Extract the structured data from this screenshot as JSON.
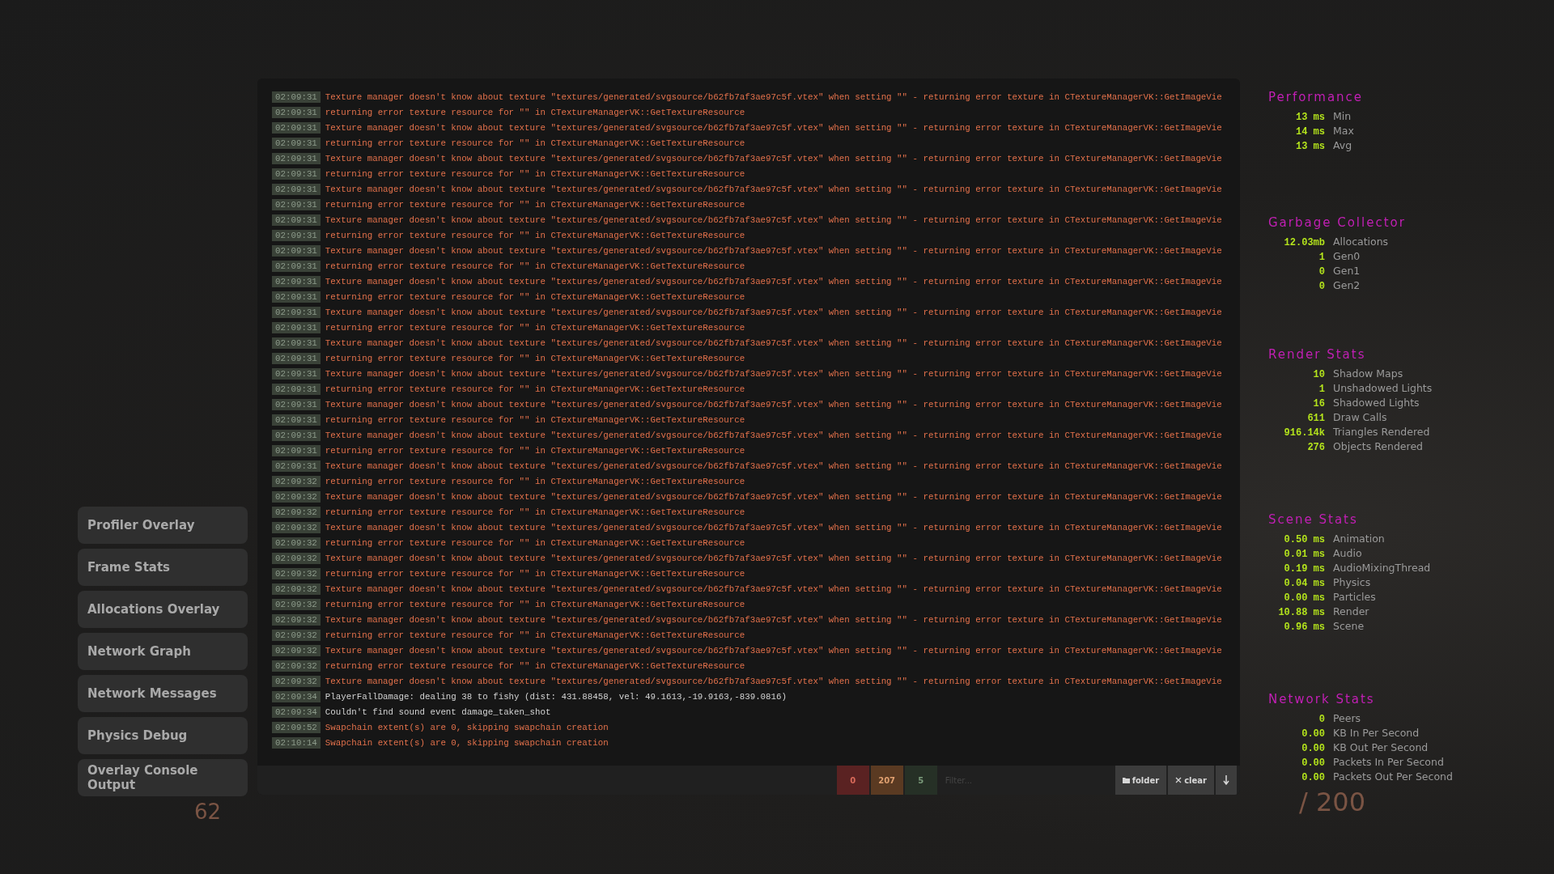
{
  "menu": [
    {
      "label": "Profiler Overlay"
    },
    {
      "label": "Frame Stats"
    },
    {
      "label": "Allocations Overlay"
    },
    {
      "label": "Network Graph"
    },
    {
      "label": "Network Messages"
    },
    {
      "label": "Physics Debug"
    },
    {
      "label": "Overlay Console Output"
    }
  ],
  "hud": {
    "left_number": "62",
    "right_number": "/ 200"
  },
  "console": {
    "lines": [
      {
        "time": "02:09:31",
        "kind": "error",
        "text": "Texture manager doesn't know about texture \"textures/generated/svgsource/b62fb7af3ae97c5f.vtex\" when setting \"\" - returning error texture in CTextureManagerVK::GetImageVie"
      },
      {
        "time": "02:09:31",
        "kind": "error",
        "text": "returning error texture resource for \"\" in CTextureManagerVK::GetTextureResource"
      },
      {
        "time": "02:09:31",
        "kind": "error",
        "text": "Texture manager doesn't know about texture \"textures/generated/svgsource/b62fb7af3ae97c5f.vtex\" when setting \"\" - returning error texture in CTextureManagerVK::GetImageVie"
      },
      {
        "time": "02:09:31",
        "kind": "error",
        "text": "returning error texture resource for \"\" in CTextureManagerVK::GetTextureResource"
      },
      {
        "time": "02:09:31",
        "kind": "error",
        "text": "Texture manager doesn't know about texture \"textures/generated/svgsource/b62fb7af3ae97c5f.vtex\" when setting \"\" - returning error texture in CTextureManagerVK::GetImageVie"
      },
      {
        "time": "02:09:31",
        "kind": "error",
        "text": "returning error texture resource for \"\" in CTextureManagerVK::GetTextureResource"
      },
      {
        "time": "02:09:31",
        "kind": "error",
        "text": "Texture manager doesn't know about texture \"textures/generated/svgsource/b62fb7af3ae97c5f.vtex\" when setting \"\" - returning error texture in CTextureManagerVK::GetImageVie"
      },
      {
        "time": "02:09:31",
        "kind": "error",
        "text": "returning error texture resource for \"\" in CTextureManagerVK::GetTextureResource"
      },
      {
        "time": "02:09:31",
        "kind": "error",
        "text": "Texture manager doesn't know about texture \"textures/generated/svgsource/b62fb7af3ae97c5f.vtex\" when setting \"\" - returning error texture in CTextureManagerVK::GetImageVie"
      },
      {
        "time": "02:09:31",
        "kind": "error",
        "text": "returning error texture resource for \"\" in CTextureManagerVK::GetTextureResource"
      },
      {
        "time": "02:09:31",
        "kind": "error",
        "text": "Texture manager doesn't know about texture \"textures/generated/svgsource/b62fb7af3ae97c5f.vtex\" when setting \"\" - returning error texture in CTextureManagerVK::GetImageVie"
      },
      {
        "time": "02:09:31",
        "kind": "error",
        "text": "returning error texture resource for \"\" in CTextureManagerVK::GetTextureResource"
      },
      {
        "time": "02:09:31",
        "kind": "error",
        "text": "Texture manager doesn't know about texture \"textures/generated/svgsource/b62fb7af3ae97c5f.vtex\" when setting \"\" - returning error texture in CTextureManagerVK::GetImageVie"
      },
      {
        "time": "02:09:31",
        "kind": "error",
        "text": "returning error texture resource for \"\" in CTextureManagerVK::GetTextureResource"
      },
      {
        "time": "02:09:31",
        "kind": "error",
        "text": "Texture manager doesn't know about texture \"textures/generated/svgsource/b62fb7af3ae97c5f.vtex\" when setting \"\" - returning error texture in CTextureManagerVK::GetImageVie"
      },
      {
        "time": "02:09:31",
        "kind": "error",
        "text": "returning error texture resource for \"\" in CTextureManagerVK::GetTextureResource"
      },
      {
        "time": "02:09:31",
        "kind": "error",
        "text": "Texture manager doesn't know about texture \"textures/generated/svgsource/b62fb7af3ae97c5f.vtex\" when setting \"\" - returning error texture in CTextureManagerVK::GetImageVie"
      },
      {
        "time": "02:09:31",
        "kind": "error",
        "text": "returning error texture resource for \"\" in CTextureManagerVK::GetTextureResource"
      },
      {
        "time": "02:09:31",
        "kind": "error",
        "text": "Texture manager doesn't know about texture \"textures/generated/svgsource/b62fb7af3ae97c5f.vtex\" when setting \"\" - returning error texture in CTextureManagerVK::GetImageVie"
      },
      {
        "time": "02:09:31",
        "kind": "error",
        "text": "returning error texture resource for \"\" in CTextureManagerVK::GetTextureResource"
      },
      {
        "time": "02:09:31",
        "kind": "error",
        "text": "Texture manager doesn't know about texture \"textures/generated/svgsource/b62fb7af3ae97c5f.vtex\" when setting \"\" - returning error texture in CTextureManagerVK::GetImageVie"
      },
      {
        "time": "02:09:31",
        "kind": "error",
        "text": "returning error texture resource for \"\" in CTextureManagerVK::GetTextureResource"
      },
      {
        "time": "02:09:31",
        "kind": "error",
        "text": "Texture manager doesn't know about texture \"textures/generated/svgsource/b62fb7af3ae97c5f.vtex\" when setting \"\" - returning error texture in CTextureManagerVK::GetImageVie"
      },
      {
        "time": "02:09:31",
        "kind": "error",
        "text": "returning error texture resource for \"\" in CTextureManagerVK::GetTextureResource"
      },
      {
        "time": "02:09:31",
        "kind": "error",
        "text": "Texture manager doesn't know about texture \"textures/generated/svgsource/b62fb7af3ae97c5f.vtex\" when setting \"\" - returning error texture in CTextureManagerVK::GetImageVie"
      },
      {
        "time": "02:09:32",
        "kind": "error",
        "text": "returning error texture resource for \"\" in CTextureManagerVK::GetTextureResource"
      },
      {
        "time": "02:09:32",
        "kind": "error",
        "text": "Texture manager doesn't know about texture \"textures/generated/svgsource/b62fb7af3ae97c5f.vtex\" when setting \"\" - returning error texture in CTextureManagerVK::GetImageVie"
      },
      {
        "time": "02:09:32",
        "kind": "error",
        "text": "returning error texture resource for \"\" in CTextureManagerVK::GetTextureResource"
      },
      {
        "time": "02:09:32",
        "kind": "error",
        "text": "Texture manager doesn't know about texture \"textures/generated/svgsource/b62fb7af3ae97c5f.vtex\" when setting \"\" - returning error texture in CTextureManagerVK::GetImageVie"
      },
      {
        "time": "02:09:32",
        "kind": "error",
        "text": "returning error texture resource for \"\" in CTextureManagerVK::GetTextureResource"
      },
      {
        "time": "02:09:32",
        "kind": "error",
        "text": "Texture manager doesn't know about texture \"textures/generated/svgsource/b62fb7af3ae97c5f.vtex\" when setting \"\" - returning error texture in CTextureManagerVK::GetImageVie"
      },
      {
        "time": "02:09:32",
        "kind": "error",
        "text": "returning error texture resource for \"\" in CTextureManagerVK::GetTextureResource"
      },
      {
        "time": "02:09:32",
        "kind": "error",
        "text": "Texture manager doesn't know about texture \"textures/generated/svgsource/b62fb7af3ae97c5f.vtex\" when setting \"\" - returning error texture in CTextureManagerVK::GetImageVie"
      },
      {
        "time": "02:09:32",
        "kind": "error",
        "text": "returning error texture resource for \"\" in CTextureManagerVK::GetTextureResource"
      },
      {
        "time": "02:09:32",
        "kind": "error",
        "text": "Texture manager doesn't know about texture \"textures/generated/svgsource/b62fb7af3ae97c5f.vtex\" when setting \"\" - returning error texture in CTextureManagerVK::GetImageVie"
      },
      {
        "time": "02:09:32",
        "kind": "error",
        "text": "returning error texture resource for \"\" in CTextureManagerVK::GetTextureResource"
      },
      {
        "time": "02:09:32",
        "kind": "error",
        "text": "Texture manager doesn't know about texture \"textures/generated/svgsource/b62fb7af3ae97c5f.vtex\" when setting \"\" - returning error texture in CTextureManagerVK::GetImageVie"
      },
      {
        "time": "02:09:32",
        "kind": "error",
        "text": "returning error texture resource for \"\" in CTextureManagerVK::GetTextureResource"
      },
      {
        "time": "02:09:32",
        "kind": "error",
        "text": "Texture manager doesn't know about texture \"textures/generated/svgsource/b62fb7af3ae97c5f.vtex\" when setting \"\" - returning error texture in CTextureManagerVK::GetImageVie"
      },
      {
        "time": "02:09:34",
        "kind": "info",
        "text": "PlayerFallDamage: dealing 38 to fishy (dist: 431.88458, vel: 49.1613,-19.9163,-839.0816)"
      },
      {
        "time": "02:09:34",
        "kind": "info",
        "text": "Couldn't find sound event damage_taken_shot"
      },
      {
        "time": "02:09:52",
        "kind": "error",
        "text": "Swapchain extent(s) are 0, skipping swapchain creation"
      },
      {
        "time": "02:10:14",
        "kind": "error",
        "text": "Swapchain extent(s) are 0, skipping swapchain creation"
      }
    ],
    "counters": [
      {
        "kind": "error",
        "label": "0"
      },
      {
        "kind": "warning",
        "label": "207"
      },
      {
        "kind": "info",
        "label": "5"
      }
    ],
    "filter": {
      "placeholder": "Filter..."
    },
    "buttons": [
      {
        "kind": "folder",
        "label": "folder"
      },
      {
        "kind": "clear",
        "label": "clear"
      },
      {
        "kind": "scroll"
      }
    ]
  },
  "stats": [
    {
      "title": "Performance",
      "rows": [
        {
          "reading": "13 ms",
          "name": "Min"
        },
        {
          "reading": "14 ms",
          "name": "Max"
        },
        {
          "reading": "13 ms",
          "name": "Avg"
        }
      ]
    },
    {
      "title": "Garbage Collector",
      "rows": [
        {
          "reading": "12.03mb",
          "name": "Allocations"
        },
        {
          "reading": "1",
          "name": "Gen0"
        },
        {
          "reading": "0",
          "name": "Gen1"
        },
        {
          "reading": "0",
          "name": "Gen2"
        }
      ]
    },
    {
      "title": "Render Stats",
      "rows": [
        {
          "reading": "10",
          "name": "Shadow Maps"
        },
        {
          "reading": "1",
          "name": "Unshadowed Lights"
        },
        {
          "reading": "16",
          "name": "Shadowed Lights"
        },
        {
          "reading": "611",
          "name": "Draw Calls"
        },
        {
          "reading": "916.14k",
          "name": "Triangles Rendered"
        },
        {
          "reading": "276",
          "name": "Objects Rendered"
        }
      ]
    },
    {
      "title": "Scene Stats",
      "rows": [
        {
          "reading": "0.50 ms",
          "name": "Animation"
        },
        {
          "reading": "0.01 ms",
          "name": "Audio"
        },
        {
          "reading": "0.19 ms",
          "name": "AudioMixingThread"
        },
        {
          "reading": "0.04 ms",
          "name": "Physics"
        },
        {
          "reading": "0.00 ms",
          "name": "Particles"
        },
        {
          "reading": "10.88 ms",
          "name": "Render"
        },
        {
          "reading": "0.96 ms",
          "name": "Scene"
        }
      ]
    },
    {
      "title": "Network Stats",
      "rows": [
        {
          "reading": "0",
          "name": "Peers"
        },
        {
          "reading": "0.00",
          "name": "KB In Per Second"
        },
        {
          "reading": "0.00",
          "name": "KB Out Per Second"
        },
        {
          "reading": "0.00",
          "name": "Packets In Per Second"
        },
        {
          "reading": "0.00",
          "name": "Packets Out Per Second"
        }
      ]
    }
  ]
}
